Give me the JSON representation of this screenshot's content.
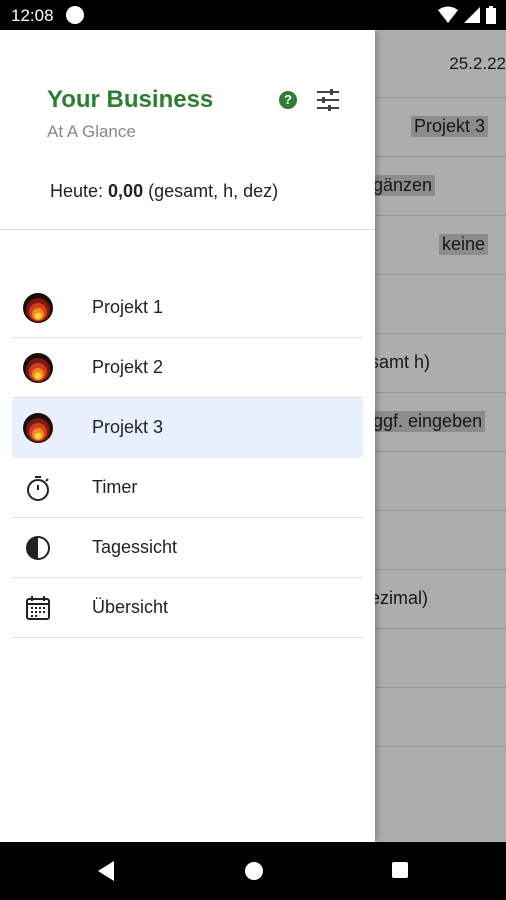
{
  "status_bar": {
    "time": "12:08"
  },
  "background": {
    "date": "25.2.22",
    "rows": [
      {
        "text": "Projekt 3",
        "highlight": true,
        "align": "right"
      },
      {
        "text": "gänzen",
        "highlight": true,
        "align": "left"
      },
      {
        "text": "keine",
        "highlight": true,
        "align": "right"
      },
      {
        "text": "",
        "highlight": false,
        "align": "left"
      },
      {
        "text": "samt h)",
        "highlight": false,
        "align": "left"
      },
      {
        "text": "ggf. eingeben",
        "highlight": true,
        "align": "left"
      },
      {
        "text": "",
        "highlight": false,
        "align": "left"
      },
      {
        "text": "",
        "highlight": false,
        "align": "left"
      },
      {
        "text": "ezimal)",
        "highlight": false,
        "align": "left"
      },
      {
        "text": "",
        "highlight": false,
        "align": "left"
      },
      {
        "text": "",
        "highlight": false,
        "align": "left"
      }
    ]
  },
  "drawer": {
    "title": "Your Business",
    "subtitle": "At A Glance",
    "today_prefix": "Heute: ",
    "today_value": "0,00",
    "today_suffix": " (gesamt, h, dez)",
    "items": [
      {
        "label": "Projekt 1",
        "icon": "project-icon"
      },
      {
        "label": "Projekt 2",
        "icon": "project-icon"
      },
      {
        "label": "Projekt 3",
        "icon": "project-icon",
        "active": true
      },
      {
        "label": "Timer",
        "icon": "stopwatch-icon"
      },
      {
        "label": "Tagessicht",
        "icon": "half-circle-icon"
      },
      {
        "label": "Übersicht",
        "icon": "calendar-icon"
      }
    ]
  },
  "colors": {
    "brand_green": "#2e7d32",
    "active_bg": "#e8f0fd"
  }
}
